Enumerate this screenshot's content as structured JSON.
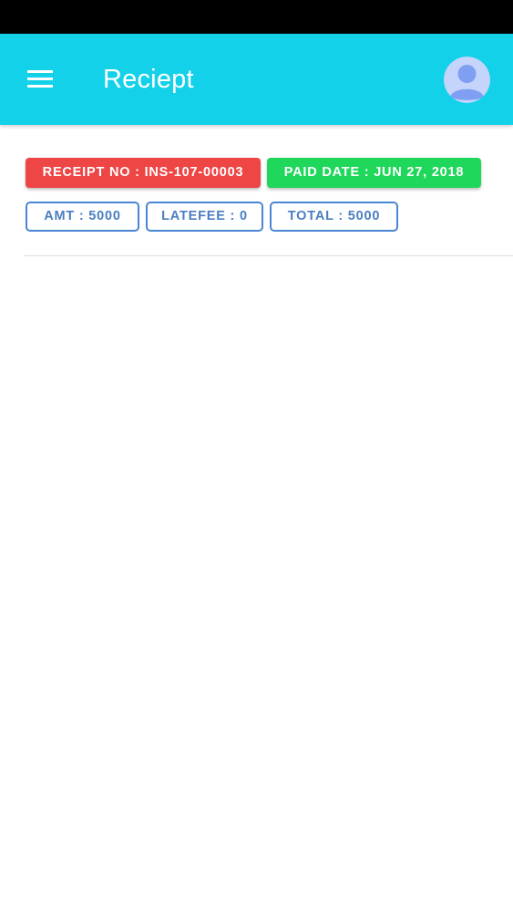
{
  "header": {
    "title": "Reciept",
    "menu_icon": "hamburger-menu-icon",
    "avatar_icon": "user-avatar-icon"
  },
  "receipt": {
    "receipt_no": "RECEIPT NO : INS-107-00003",
    "paid_date": "PAID DATE : JUN 27, 2018",
    "amount": "AMT : 5000",
    "late_fee": "LATEFEE : 0",
    "total": "TOTAL : 5000"
  },
  "colors": {
    "app_bar": "#14d1ea",
    "receipt_chip": "#ee4545",
    "date_chip": "#1fd75a",
    "outline_chip": "#4a86d4",
    "avatar_bg": "#c5d4fb",
    "avatar_fg": "#7f9ff2"
  }
}
